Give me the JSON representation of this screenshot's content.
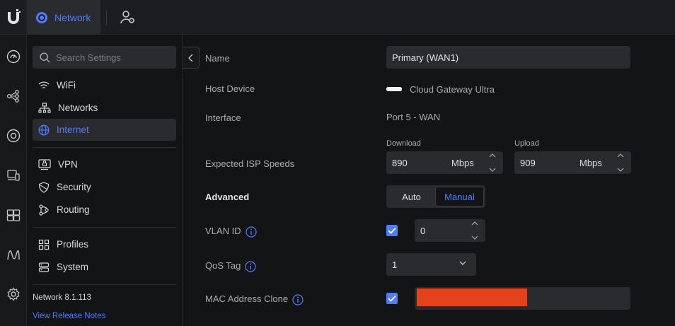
{
  "topbar": {
    "app_label": "Network",
    "colors": {
      "accent": "#4c7dff",
      "bg": "#1c1d20"
    }
  },
  "rail": {
    "icons": [
      "dashboard-icon",
      "topology-icon",
      "devices-icon",
      "clients-icon",
      "ports-icon",
      "insights-icon",
      "settings-icon"
    ]
  },
  "sidebar": {
    "search_placeholder": "Search Settings",
    "items": [
      {
        "label": "WiFi",
        "icon": "wifi-icon"
      },
      {
        "label": "Networks",
        "icon": "networks-icon"
      },
      {
        "label": "Internet",
        "icon": "globe-icon",
        "active": true
      },
      {
        "label": "VPN",
        "icon": "vpn-icon"
      },
      {
        "label": "Security",
        "icon": "shield-icon"
      },
      {
        "label": "Routing",
        "icon": "routing-icon"
      },
      {
        "label": "Profiles",
        "icon": "profiles-icon"
      },
      {
        "label": "System",
        "icon": "system-icon"
      }
    ],
    "version": "Network 8.1.113",
    "release_notes": "View Release Notes"
  },
  "form": {
    "name": {
      "label": "Name",
      "value": "Primary (WAN1)"
    },
    "host_device": {
      "label": "Host Device",
      "value": "Cloud Gateway Ultra"
    },
    "interface": {
      "label": "Interface",
      "value": "Port 5 - WAN"
    },
    "isp_speeds": {
      "label": "Expected ISP Speeds",
      "download_caption": "Download",
      "download_value": "890",
      "upload_caption": "Upload",
      "upload_value": "909",
      "unit": "Mbps"
    },
    "advanced": {
      "label": "Advanced",
      "options": [
        "Auto",
        "Manual"
      ],
      "selected": "Manual"
    },
    "vlan_id": {
      "label": "VLAN ID",
      "checked": true,
      "value": "0"
    },
    "qos_tag": {
      "label": "QoS Tag",
      "value": "1"
    },
    "mac_clone": {
      "label": "MAC Address Clone",
      "checked": true,
      "redaction_color": "#e3421a"
    }
  }
}
